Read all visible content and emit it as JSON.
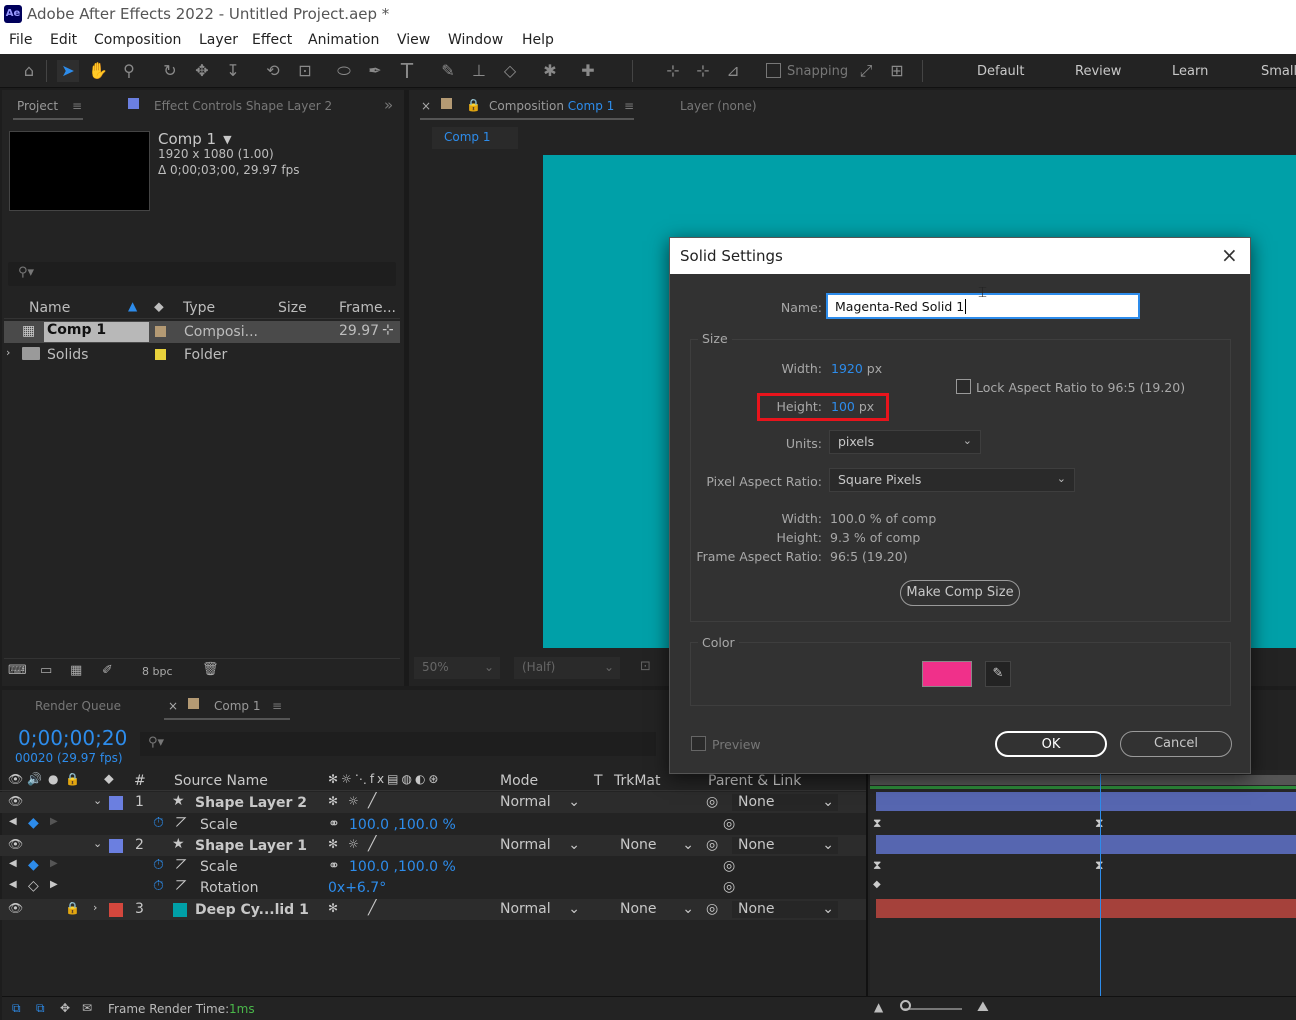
{
  "window": {
    "title": "Adobe After Effects 2022 - Untitled Project.aep *",
    "app_badge": "Ae"
  },
  "menu": [
    "File",
    "Edit",
    "Composition",
    "Layer",
    "Effect",
    "Animation",
    "View",
    "Window",
    "Help"
  ],
  "toolbar": {
    "snapping_label": "Snapping",
    "workspaces": [
      "Default",
      "Review",
      "Learn",
      "Small"
    ]
  },
  "project_panel": {
    "tab_project": "Project",
    "tab_effect_controls": "Effect Controls",
    "effect_controls_target": "Shape Layer 2",
    "selected_item": {
      "name": "Comp 1",
      "resolution": "1920 x 1080 (1.00)",
      "duration": "Δ 0;00;03;00, 29.97 fps"
    },
    "columns": [
      "Name",
      "Type",
      "Size",
      "Frame..."
    ],
    "items": [
      {
        "name": "Comp 1",
        "type": "Composi...",
        "frame_rate": "29.97",
        "label_color": "#b49a74"
      },
      {
        "name": "Solids",
        "type": "Folder",
        "frame_rate": "",
        "label_color": "#e8d23c"
      }
    ],
    "bpc": "8 bpc"
  },
  "composition_panel": {
    "tab_label": "Composition",
    "comp_name": "Comp 1",
    "layer_tab": "Layer (none)",
    "sub_tab": "Comp 1",
    "zoom": "50%",
    "resolution": "(Half)",
    "canvas_color": "#00a0a8"
  },
  "timeline": {
    "render_queue_tab": "Render Queue",
    "comp_tab": "Comp 1",
    "timecode": "0;00;00;20",
    "frame_info": "00020 (29.97 fps)",
    "columns": {
      "num": "#",
      "source": "Source Name",
      "mode": "Mode",
      "t": "T",
      "trkmat": "TrkMat",
      "parent": "Parent & Link"
    },
    "layers": [
      {
        "num": "1",
        "name": "Shape Layer 2",
        "label_color": "#6b7fe0",
        "mode": "Normal",
        "trkmat": "",
        "parent": "None",
        "props": [
          {
            "name": "Scale",
            "value": "100.0 ,100.0 %"
          }
        ]
      },
      {
        "num": "2",
        "name": "Shape Layer 1",
        "label_color": "#6b7fe0",
        "mode": "Normal",
        "trkmat": "None",
        "parent": "None",
        "props": [
          {
            "name": "Scale",
            "value": "100.0 ,100.0 %"
          },
          {
            "name": "Rotation",
            "value": "0x+6.7°"
          }
        ]
      },
      {
        "num": "3",
        "name": "Deep Cy...lid 1",
        "label_color": "#d3473d",
        "mode": "Normal",
        "trkmat": "None",
        "parent": "None",
        "props": []
      }
    ],
    "footer": {
      "render_time_label": "Frame Render Time:",
      "render_time_value": "1ms"
    }
  },
  "dialog": {
    "title": "Solid Settings",
    "name_label": "Name:",
    "name_value": "Magenta-Red Solid 1",
    "size_group": "Size",
    "width_label": "Width:",
    "width_value": "1920",
    "height_label": "Height:",
    "height_value": "100",
    "px": "px",
    "lock_aspect": "Lock Aspect Ratio to 96:5 (19.20)",
    "units_label": "Units:",
    "units_value": "pixels",
    "par_label": "Pixel Aspect Ratio:",
    "par_value": "Square Pixels",
    "pct_width_label": "Width:",
    "pct_width_value": "100.0 % of comp",
    "pct_height_label": "Height:",
    "pct_height_value": "9.3 % of comp",
    "far_label": "Frame Aspect Ratio:",
    "far_value": "96:5 (19.20)",
    "make_comp_size": "Make Comp Size",
    "color_group": "Color",
    "color_value": "#f0308a",
    "preview_label": "Preview",
    "ok": "OK",
    "cancel": "Cancel"
  }
}
